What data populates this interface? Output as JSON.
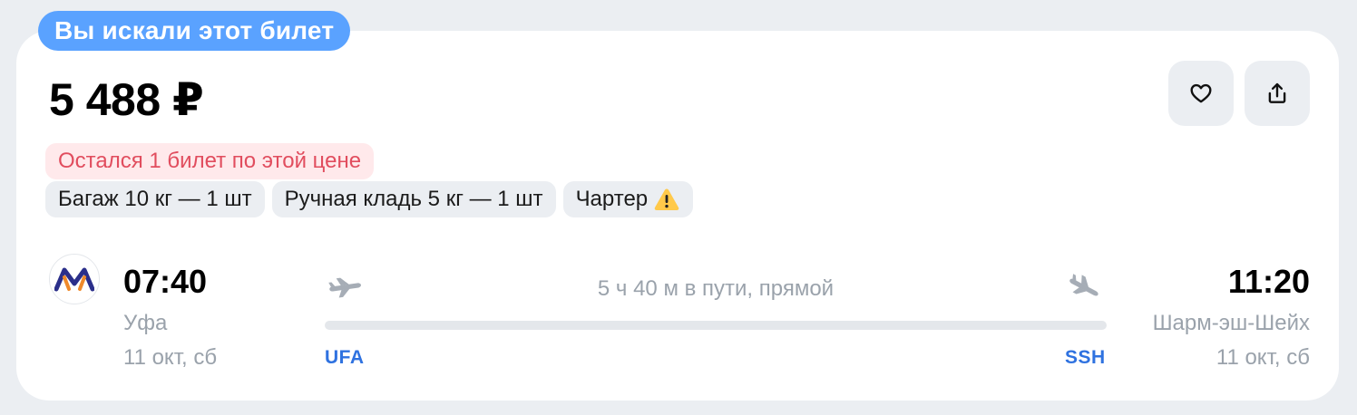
{
  "badge": {
    "label": "Вы искали этот билет"
  },
  "ticket": {
    "price": "5 488 ₽",
    "availability": "Остался 1 билет по этой цене",
    "tags": {
      "baggage": "Багаж 10 кг — 1 шт",
      "hand_luggage": "Ручная кладь 5 кг — 1 шт",
      "charter": "Чартер"
    },
    "actions": {
      "favorite_icon": "heart-icon",
      "share_icon": "share-icon"
    }
  },
  "flight": {
    "departure": {
      "time": "07:40",
      "city": "Уфа",
      "date": "11 окт, сб",
      "iata": "UFA"
    },
    "arrival": {
      "time": "11:20",
      "city": "Шарм-эш-Шейх",
      "date": "11 окт, сб",
      "iata": "SSH"
    },
    "duration": "5 ч 40 м в пути, прямой"
  },
  "colors": {
    "badge": "#5aa2ff",
    "warning_text": "#e14d5e",
    "warning_bg": "#ffe9eb",
    "iata": "#2f72e0",
    "muted": "#9aa2ab",
    "chip_bg": "#ebeef2"
  }
}
